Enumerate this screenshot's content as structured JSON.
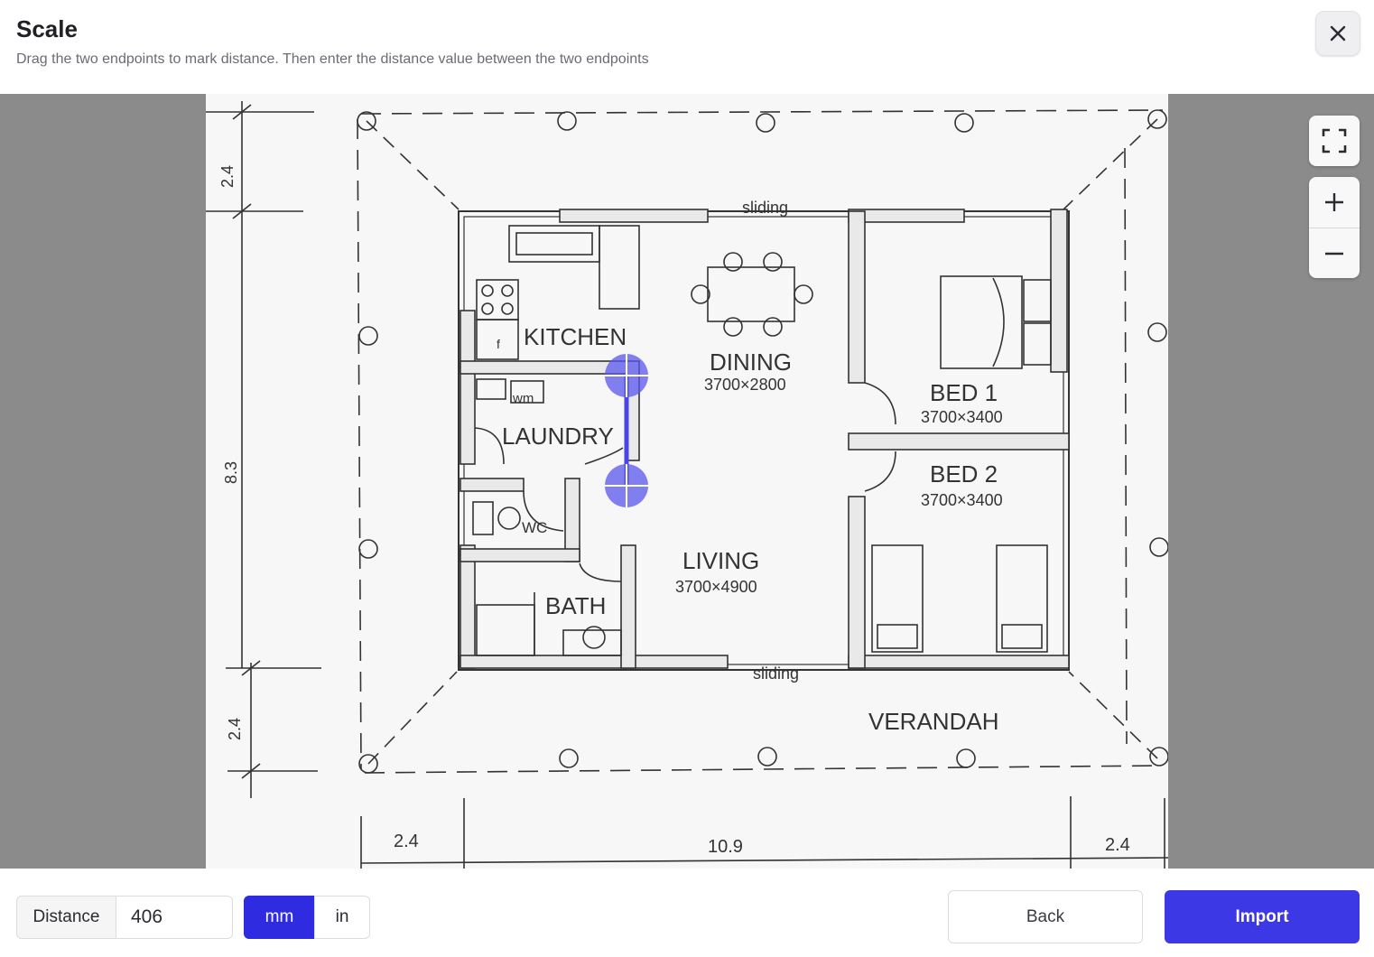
{
  "header": {
    "title": "Scale",
    "subtitle": "Drag the two endpoints to mark distance. Then enter the distance value between the two endpoints"
  },
  "icons": {
    "close": "close-icon",
    "fullscreen": "fullscreen-icon",
    "zoom_in": "plus-icon",
    "zoom_out": "minus-icon"
  },
  "plan": {
    "rooms": {
      "kitchen": "KITCHEN",
      "laundry": "LAUNDRY",
      "wm": "wm",
      "fridge": "f",
      "wc": "WC",
      "bath": "BATH",
      "dining": "DINING",
      "dining_size": "3700×2800",
      "living": "LIVING",
      "living_size": "3700×4900",
      "bed1": "BED 1",
      "bed1_size": "3700×3400",
      "bed2": "BED 2",
      "bed2_size": "3700×3400",
      "verandah": "VERANDAH",
      "sliding_top": "sliding",
      "sliding_bottom": "sliding"
    },
    "dimensions": {
      "left_top": "2.4",
      "left_mid": "8.3",
      "left_bottom": "2.4",
      "bottom_left": "2.4",
      "bottom_mid": "10.9",
      "bottom_right": "2.4"
    }
  },
  "footer": {
    "distance_label": "Distance",
    "distance_value": "406",
    "unit_mm": "mm",
    "unit_in": "in",
    "active_unit": "mm",
    "back_label": "Back",
    "import_label": "Import"
  },
  "colors": {
    "accent": "#3d38e6",
    "marker": "#5a55ee"
  }
}
